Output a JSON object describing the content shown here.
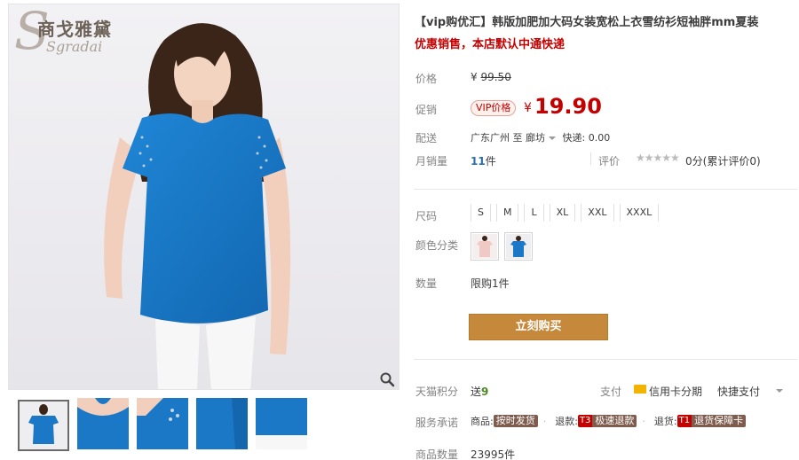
{
  "brand": {
    "name_cn": "商戈雅黛",
    "name_en": "Sgradai"
  },
  "product": {
    "title": "【vip购优汇】韩版加肥加大码女装宽松上衣雪纺衫短袖胖mm夏装",
    "subtitle": "优惠销售，本店默认中通快递"
  },
  "price": {
    "label": "价格",
    "currency": "¥",
    "original": "99.50",
    "promo_label": "促销",
    "vip_tag": "VIP价格",
    "promo": "19.90"
  },
  "shipping": {
    "label": "配送",
    "from": "广东广州",
    "to_word": "至",
    "to": "廊坊",
    "fee": "快递: 0.00"
  },
  "sales": {
    "label": "月销量",
    "count": "11",
    "unit": "件",
    "rating_label": "评价",
    "stars": "★★★★★",
    "rating_text": "0分(累计评价0)"
  },
  "sizes": {
    "label": "尺码",
    "options": [
      "S",
      "M",
      "L",
      "XL",
      "XXL",
      "XXXL"
    ]
  },
  "colors": {
    "label": "颜色分类",
    "options": [
      "pink",
      "blue"
    ]
  },
  "quantity": {
    "label": "数量",
    "limit": "限购1件"
  },
  "buy_button": "立刻购买",
  "points": {
    "label": "天猫积分",
    "prefix": "送",
    "value": "9"
  },
  "payment": {
    "label": "支付",
    "card": "信用卡分期",
    "quick": "快捷支付"
  },
  "services": {
    "label": "服务承诺",
    "items": [
      {
        "prefix": "商品:",
        "badge": "按时发货"
      },
      {
        "prefix": "退款:",
        "badge_a": "T3",
        "badge_b": "极速退款"
      },
      {
        "prefix": "退货:",
        "badge_a": "T1",
        "badge_b": "退货保障卡"
      }
    ]
  },
  "stock": {
    "label": "商品数量",
    "value": "23995件"
  },
  "colors_theme": {
    "price_red": "#c40000",
    "buy_button": "#c6893c",
    "shirt_blue": "#1a78c6"
  }
}
